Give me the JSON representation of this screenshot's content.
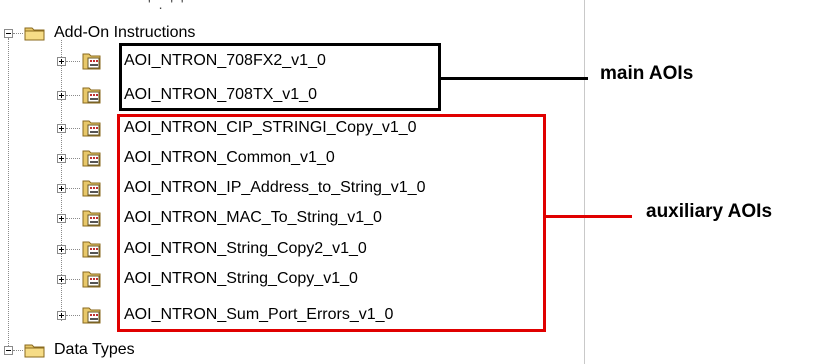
{
  "tree": {
    "top_fragment": "' . ' '",
    "groups": [
      {
        "label": "Add-On Instructions",
        "children": [
          "AOI_NTRON_708FX2_v1_0",
          "AOI_NTRON_708TX_v1_0",
          "AOI_NTRON_CIP_STRINGI_Copy_v1_0",
          "AOI_NTRON_Common_v1_0",
          "AOI_NTRON_IP_Address_to_String_v1_0",
          "AOI_NTRON_MAC_To_String_v1_0",
          "AOI_NTRON_String_Copy2_v1_0",
          "AOI_NTRON_String_Copy_v1_0",
          "AOI_NTRON_Sum_Port_Errors_v1_0"
        ]
      },
      {
        "label": "Data Types"
      }
    ]
  },
  "annotations": {
    "main": {
      "label": "main AOIs",
      "color": "#000000"
    },
    "auxiliary": {
      "label": "auxiliary AOIs",
      "color": "#e00000"
    }
  },
  "icons": {
    "folder": "folder-icon",
    "aoi": "add-on-instruction-icon",
    "expander": "tree-expander-icon"
  }
}
